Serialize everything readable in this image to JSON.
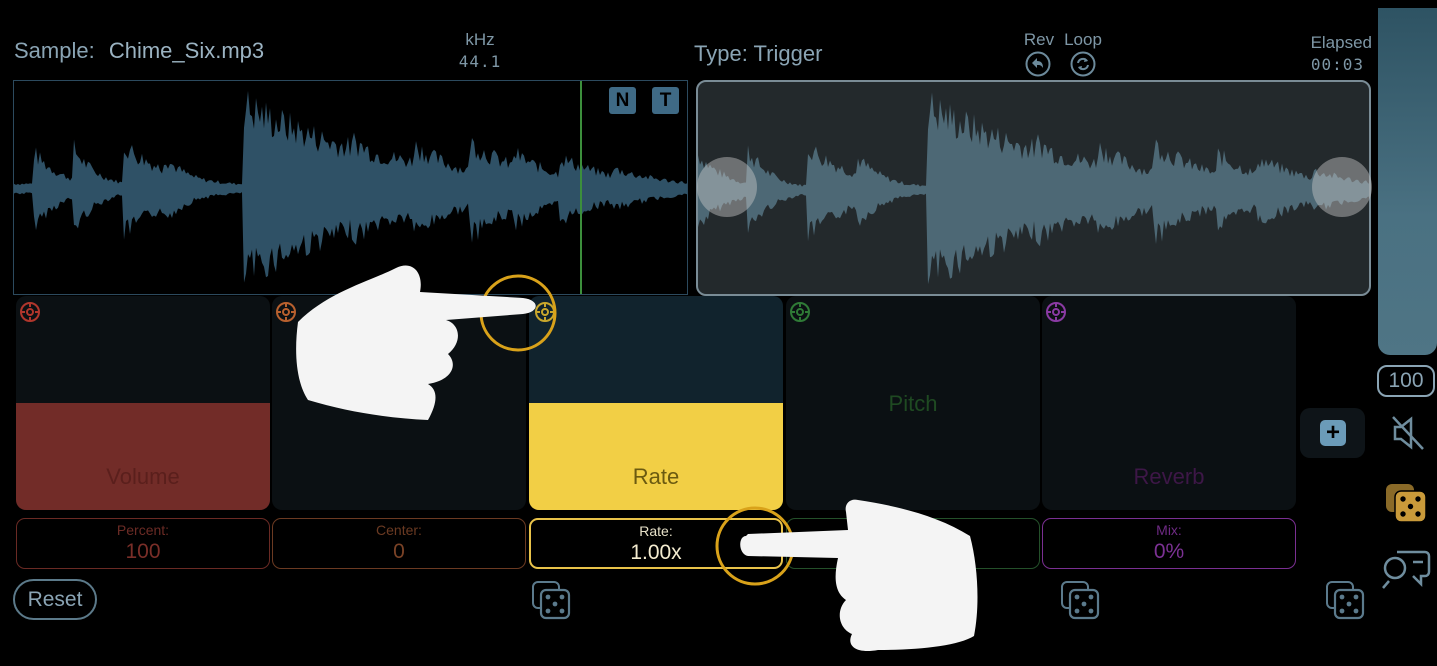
{
  "header": {
    "sample_label": "Sample:",
    "sample_name": "Chime_Six.mp3",
    "khz_label": "kHz",
    "khz_value": "44.1",
    "type_label": "Type: Trigger",
    "rev_label": "Rev",
    "loop_label": "Loop",
    "elapsed_label": "Elapsed",
    "elapsed_value": "00:03"
  },
  "waveform": {
    "n_button": "N",
    "t_button": "T"
  },
  "volume_slider": {
    "value": "100",
    "level": 1.0
  },
  "cards": [
    {
      "label": "Volume",
      "value_title": "Percent:",
      "value": "100",
      "color": "#c8443a",
      "fill_level": 0.5
    },
    {
      "label": "",
      "value_title": "Center:",
      "value": "0",
      "color": "#c7653f",
      "fill_level": 0
    },
    {
      "label": "Rate",
      "value_title": "Rate:",
      "value": "1.00x",
      "color": "#f2cf45",
      "fill_level": 0.5
    },
    {
      "label": "Pitch",
      "value_title": "",
      "value": "",
      "color": "#2f7a36",
      "fill_level": 0
    },
    {
      "label": "Reverb",
      "value_title": "Mix:",
      "value": "0%",
      "color": "#9a3fb0",
      "fill_level": 0
    }
  ],
  "footer": {
    "reset_label": "Reset"
  },
  "colors": {
    "background": "#000000",
    "accent_blue": "#3f6a85",
    "highlight_ring": "#d9a21a"
  },
  "icons": [
    "gear-icon",
    "dice-icon",
    "plus-icon",
    "mute-icon",
    "rev-icon",
    "loop-icon",
    "chat-icon"
  ]
}
